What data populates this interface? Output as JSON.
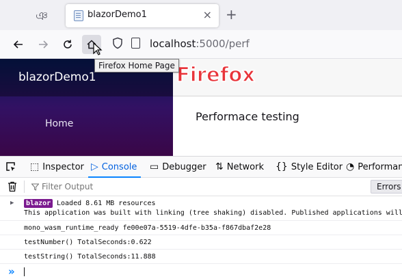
{
  "browser": {
    "tab_title": "blazorDemo1",
    "tab_close": "×",
    "new_tab": "+",
    "extra_icon": "ঞ",
    "url_host": "localhost",
    "url_rest": ":5000/perf",
    "tooltip": "Firefox Home Page"
  },
  "overlay": {
    "label": "Firefox"
  },
  "page": {
    "brand": "blazorDemo1",
    "nav_home": "Home",
    "heading": "Performace testing"
  },
  "devtools": {
    "tabs": {
      "inspector": "Inspector",
      "console": "Console",
      "debugger": "Debugger",
      "network": "Network",
      "style_editor": "Style Editor",
      "performance": "Performan"
    },
    "filter_placeholder": "Filter Output",
    "errors_label": "Errors",
    "logs": [
      {
        "badge": "blazor",
        "line1": "Loaded 8.61 MB resources",
        "line2": "This application was built with linking (tree shaking) disabled. Published applications will"
      },
      {
        "text": "mono_wasm_runtime_ready fe00e07a-5519-4dfe-b35a-f867dbaf2e28"
      },
      {
        "text": "testNumber() TotalSeconds:0.622"
      },
      {
        "text": "testString() TotalSeconds:11.888"
      }
    ],
    "prompt": "»"
  }
}
